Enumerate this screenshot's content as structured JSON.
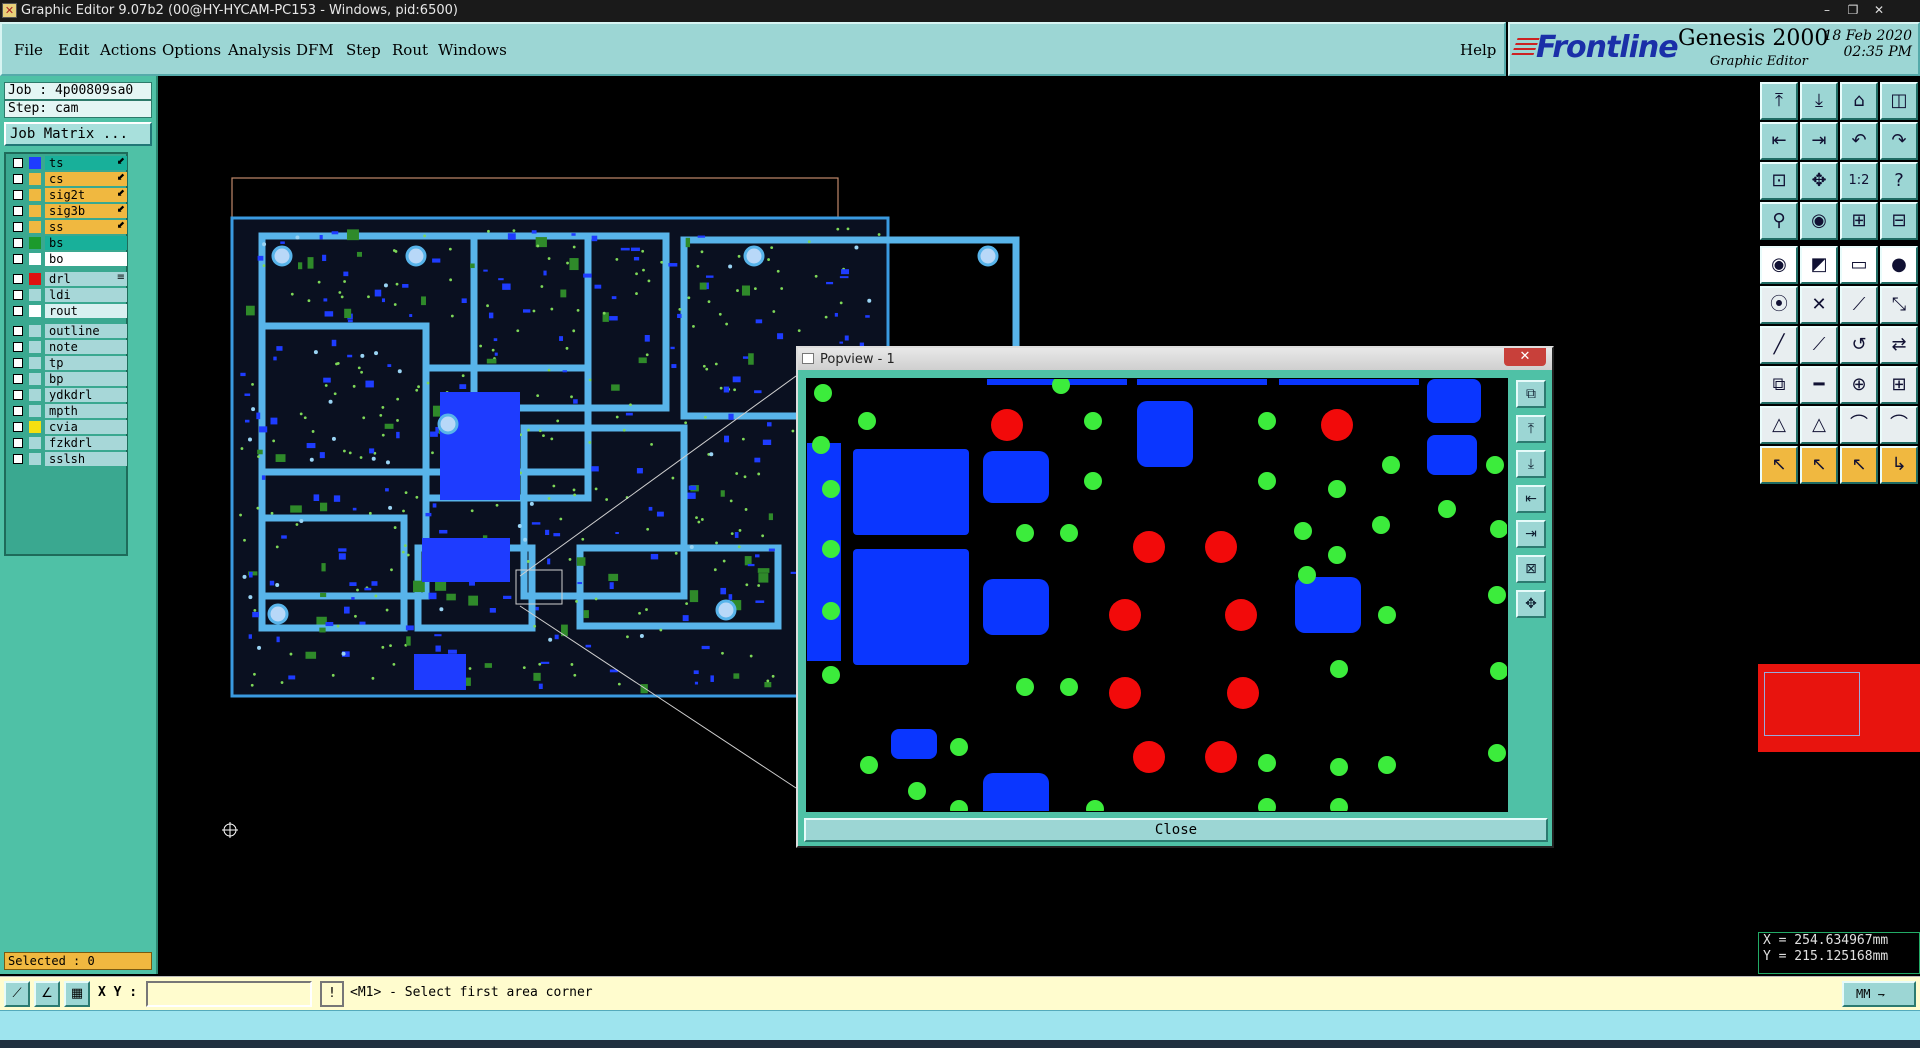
{
  "window": {
    "title": "Graphic Editor 9.07b2 (00@HY-HYCAM-PC153 - Windows, pid:6500)",
    "controls": [
      "–",
      "❐",
      "✕"
    ]
  },
  "menu": {
    "items": [
      {
        "label": "File"
      },
      {
        "label": "Edit"
      },
      {
        "label": "Actions"
      },
      {
        "label": "Options"
      },
      {
        "label": "Analysis"
      },
      {
        "label": "DFM"
      },
      {
        "label": "Step"
      },
      {
        "label": "Rout"
      },
      {
        "label": "Windows"
      }
    ],
    "help": "Help"
  },
  "brand": {
    "logo": "Frontline",
    "product": "Genesis 2000",
    "subtitle": "Graphic Editor",
    "date": "18 Feb 2020",
    "time": "02:35 PM"
  },
  "left_panel": {
    "job": "Job : 4p00809sa0",
    "step": "Step: cam",
    "job_matrix": "Job Matrix ...",
    "selected": "Selected : 0",
    "layers": [
      {
        "name": "ts",
        "color": "#1e3cff",
        "bg": "#18b09a",
        "mark": "⬋",
        "active": true
      },
      {
        "name": "cs",
        "color": "#f0b840",
        "bg": "#f0b840",
        "mark": "⬋"
      },
      {
        "name": "sig2t",
        "color": "#f0b840",
        "bg": "#f0b840",
        "mark": "⬋"
      },
      {
        "name": "sig3b",
        "color": "#f0b840",
        "bg": "#f0b840",
        "mark": "⬋"
      },
      {
        "name": "ss",
        "color": "#f0b840",
        "bg": "#f0b840",
        "mark": "⬋"
      },
      {
        "name": "bs",
        "color": "#1c9a2c",
        "bg": "#18b09a",
        "mark": ""
      },
      {
        "name": "bo",
        "color": "#ffffff",
        "bg": "#ffffff",
        "mark": ""
      },
      {
        "name": "drl",
        "color": "#e01010",
        "bg": "#a7d7d8",
        "mark": "≡"
      },
      {
        "name": "ldi",
        "color": "#a7d7d8",
        "bg": "#a7d7d8",
        "mark": ""
      },
      {
        "name": "rout",
        "color": "#ffffff",
        "bg": "#d8f0f0",
        "mark": ""
      },
      {
        "name": "outline",
        "color": "#a7d7d8",
        "bg": "#a7d7d8",
        "mark": ""
      },
      {
        "name": "note",
        "color": "#a7d7d8",
        "bg": "#a7d7d8",
        "mark": ""
      },
      {
        "name": "tp",
        "color": "#a7d7d8",
        "bg": "#a7d7d8",
        "mark": ""
      },
      {
        "name": "bp",
        "color": "#a7d7d8",
        "bg": "#a7d7d8",
        "mark": ""
      },
      {
        "name": "ydkdrl",
        "color": "#a7d7d8",
        "bg": "#a7d7d8",
        "mark": ""
      },
      {
        "name": "mpth",
        "color": "#a7d7d8",
        "bg": "#a7d7d8",
        "mark": ""
      },
      {
        "name": "cvia",
        "color": "#f5e010",
        "bg": "#a7d7d8",
        "mark": ""
      },
      {
        "name": "fzkdrl",
        "color": "#a7d7d8",
        "bg": "#a7d7d8",
        "mark": ""
      },
      {
        "name": "sslsh",
        "color": "#a7d7d8",
        "bg": "#a7d7d8",
        "mark": ""
      }
    ]
  },
  "popview": {
    "title": "Popview - 1",
    "close_label": "Close",
    "tools": [
      "zoom-fit-icon",
      "zoom-in-icon",
      "zoom-out-icon",
      "pan-left-icon",
      "pan-right-icon",
      "zoom-all-icon",
      "center-icon"
    ]
  },
  "right_tools": [
    "open-icon",
    "save-icon",
    "home-icon",
    "layout-icon",
    "prev-icon",
    "next-icon",
    "undo-icon",
    "redo-icon",
    "fit-icon",
    "center-icon",
    "one-to-one-icon",
    "help-icon",
    "snap-icon",
    "measure-icon",
    "net-icon",
    "net-alt-icon",
    "pad-icon",
    "select-area-icon",
    "ruler-icon",
    "dot-icon",
    "node-icon",
    "cross-icon",
    "connect-icon",
    "pin-icon",
    "line-icon",
    "diag-icon",
    "arc-icon",
    "route-icon",
    "copy-icon",
    "trim-icon",
    "align-icon",
    "swap-icon",
    "tri-icon",
    "tri-alt-icon",
    "arch-icon",
    "arch-alt-icon",
    "pointer-icon",
    "pointer-alt-icon",
    "pointer-red-icon",
    "pointer-path-icon"
  ],
  "coords": {
    "x": "X = 254.634967mm",
    "y": "Y = 215.125168mm"
  },
  "status": {
    "xy_label": "X Y :",
    "xy_value": "",
    "prompt": "<M1> - Select first area corner",
    "units": "MM"
  }
}
